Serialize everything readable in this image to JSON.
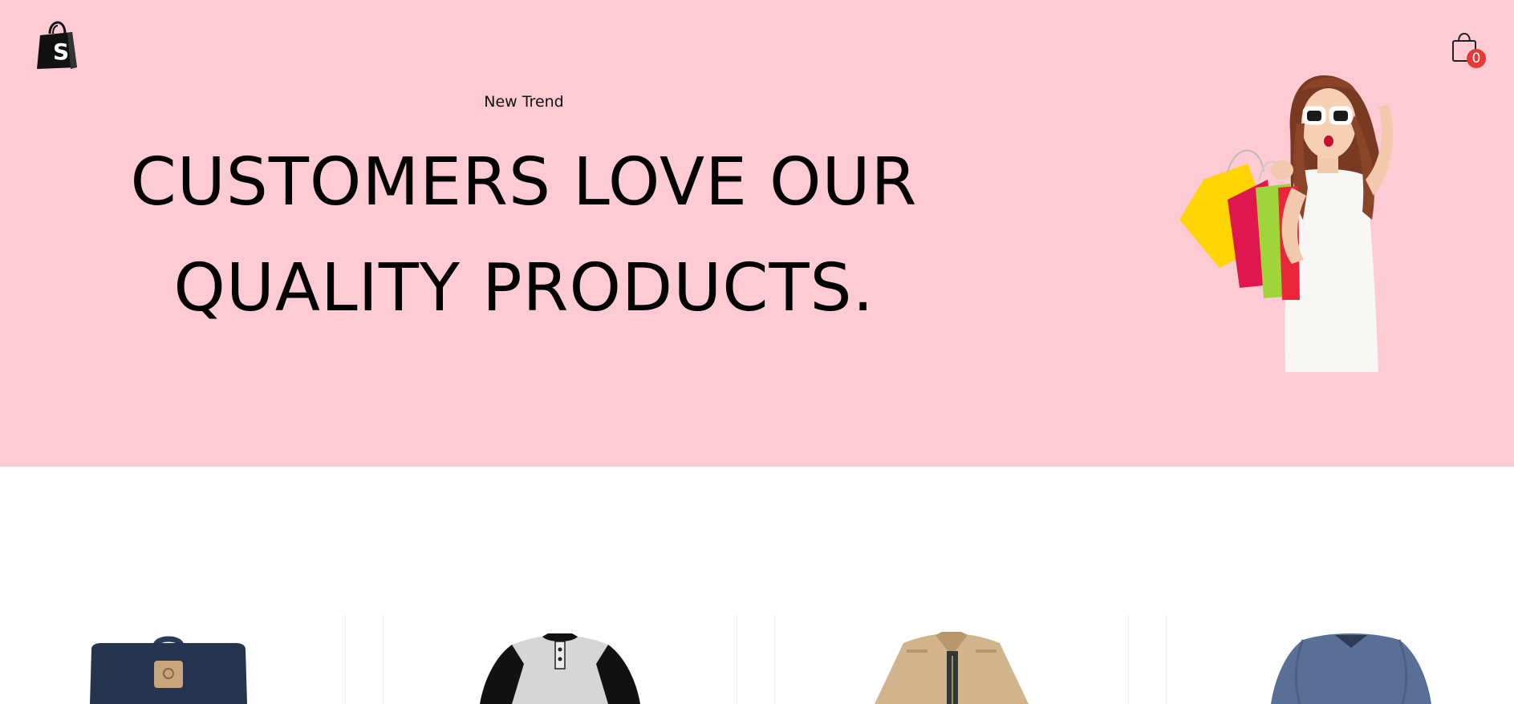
{
  "header": {
    "logo_icon": "shopify-bag-icon",
    "cart_icon": "shopping-bag-icon",
    "cart_count": "0",
    "badge_color": "#e53935"
  },
  "hero": {
    "background_color": "#fecad4",
    "eyebrow": "New Trend",
    "headline": "CUSTOMERS LOVE OUR QUALITY PRODUCTS.",
    "image": "woman-with-sunglasses-holding-shopping-bags"
  },
  "products": [
    {
      "image": "navy-messenger-bag"
    },
    {
      "image": "black-gray-raglan-henley-shirt"
    },
    {
      "image": "beige-jacket"
    },
    {
      "image": "blue-long-sleeve-v-neck-shirt"
    }
  ]
}
